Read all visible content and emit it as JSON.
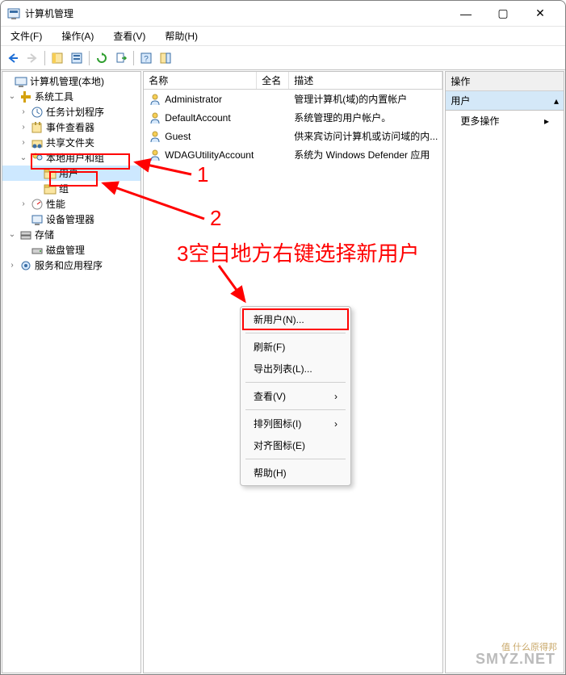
{
  "window": {
    "title": "计算机管理"
  },
  "menus": {
    "file": "文件(F)",
    "action": "操作(A)",
    "view": "查看(V)",
    "help": "帮助(H)"
  },
  "tree": {
    "root": "计算机管理(本地)",
    "system_tools": "系统工具",
    "task_scheduler": "任务计划程序",
    "event_viewer": "事件查看器",
    "shared_folders": "共享文件夹",
    "local_users_groups": "本地用户和组",
    "users": "用户",
    "groups": "组",
    "performance": "性能",
    "device_manager": "设备管理器",
    "storage": "存储",
    "disk_management": "磁盘管理",
    "services_apps": "服务和应用程序"
  },
  "list": {
    "col_name": "名称",
    "col_fullname": "全名",
    "col_desc": "描述",
    "rows": [
      {
        "name": "Administrator",
        "full": "",
        "desc": "管理计算机(域)的内置帐户"
      },
      {
        "name": "DefaultAccount",
        "full": "",
        "desc": "系统管理的用户帐户。"
      },
      {
        "name": "Guest",
        "full": "",
        "desc": "供来宾访问计算机或访问域的内..."
      },
      {
        "name": "WDAGUtilityAccount",
        "full": "",
        "desc": "系统为 Windows Defender 应用"
      }
    ]
  },
  "actions": {
    "header": "操作",
    "section": "用户",
    "more": "更多操作"
  },
  "context_menu": {
    "new_user": "新用户(N)...",
    "refresh": "刷新(F)",
    "export_list": "导出列表(L)...",
    "view": "查看(V)",
    "arrange_icons": "排列图标(I)",
    "align_icons": "对齐图标(E)",
    "help": "帮助(H)"
  },
  "annotations": {
    "a1": "1",
    "a2": "2",
    "a3": "3空白地方右键选择新用户"
  },
  "watermark": "SMYZ.NET",
  "watermark2": "值 什么原得邦"
}
